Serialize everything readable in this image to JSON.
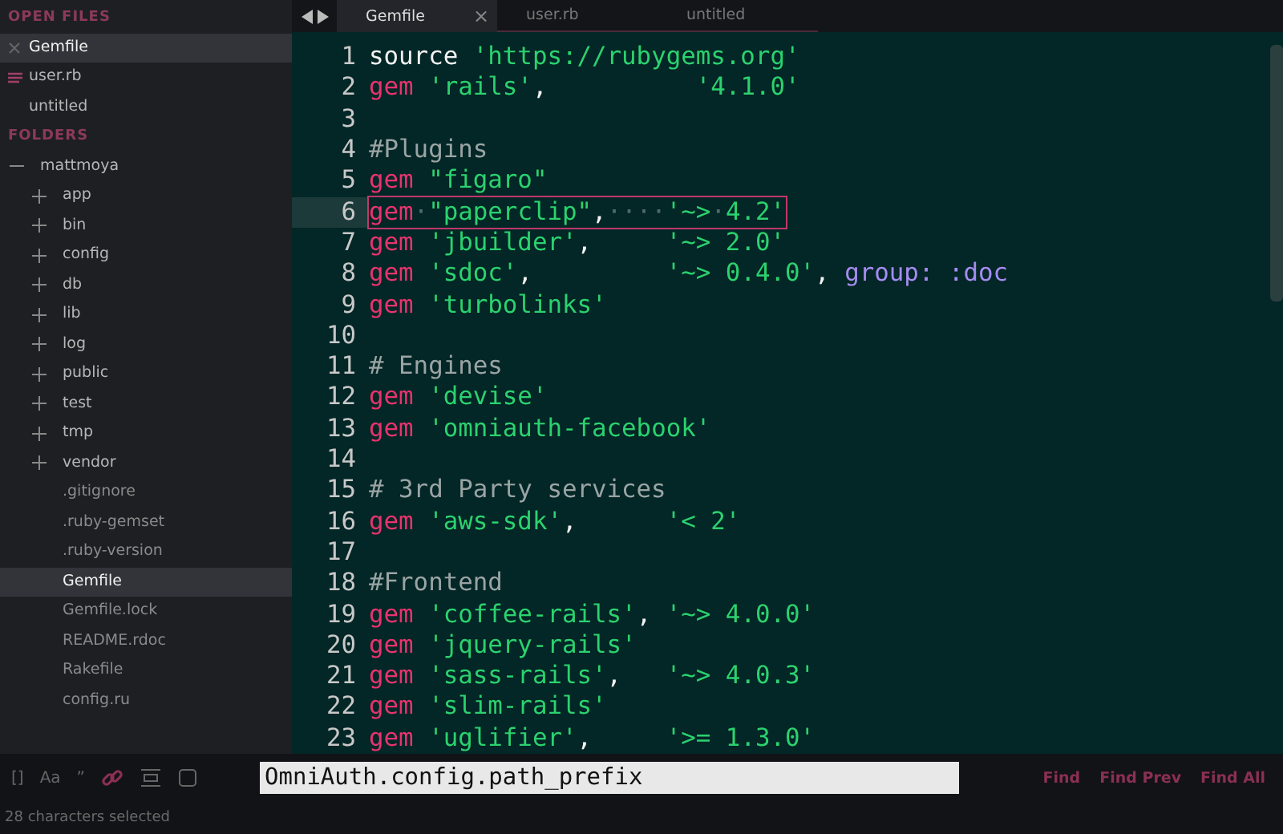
{
  "sidebar": {
    "open_files_header": "OPEN FILES",
    "open_files": [
      {
        "label": "Gemfile",
        "selected": true,
        "modified": false
      },
      {
        "label": "user.rb",
        "selected": false,
        "modified": true
      },
      {
        "label": "untitled",
        "selected": false,
        "modified": false
      }
    ],
    "folders_header": "FOLDERS",
    "tree": [
      {
        "label": "mattmoya",
        "kind": "folder",
        "expanded": true,
        "selected": false,
        "children": [
          {
            "label": "app",
            "kind": "folder",
            "expanded": false,
            "selected": false
          },
          {
            "label": "bin",
            "kind": "folder",
            "expanded": false,
            "selected": false
          },
          {
            "label": "config",
            "kind": "folder",
            "expanded": false,
            "selected": false
          },
          {
            "label": "db",
            "kind": "folder",
            "expanded": false,
            "selected": false
          },
          {
            "label": "lib",
            "kind": "folder",
            "expanded": false,
            "selected": false
          },
          {
            "label": "log",
            "kind": "folder",
            "expanded": false,
            "selected": false
          },
          {
            "label": "public",
            "kind": "folder",
            "expanded": false,
            "selected": false
          },
          {
            "label": "test",
            "kind": "folder",
            "expanded": false,
            "selected": false
          },
          {
            "label": "tmp",
            "kind": "folder",
            "expanded": false,
            "selected": false
          },
          {
            "label": "vendor",
            "kind": "folder",
            "expanded": false,
            "selected": false
          },
          {
            "label": ".gitignore",
            "kind": "file",
            "selected": false
          },
          {
            "label": ".ruby-gemset",
            "kind": "file",
            "selected": false
          },
          {
            "label": ".ruby-version",
            "kind": "file",
            "selected": false
          },
          {
            "label": "Gemfile",
            "kind": "file",
            "selected": true
          },
          {
            "label": "Gemfile.lock",
            "kind": "file",
            "selected": false
          },
          {
            "label": "README.rdoc",
            "kind": "file",
            "selected": false
          },
          {
            "label": "Rakefile",
            "kind": "file",
            "selected": false
          },
          {
            "label": "config.ru",
            "kind": "file",
            "selected": false
          }
        ]
      }
    ]
  },
  "tabs": [
    {
      "label": "Gemfile",
      "selected": true,
      "close": "×"
    },
    {
      "label": "user.rb",
      "selected": false
    },
    {
      "label": "untitled",
      "selected": false
    }
  ],
  "editor": {
    "lines": [
      {
        "number": "1",
        "tokens": [
          {
            "kind": "plain",
            "text": "source"
          },
          {
            "kind": "string",
            "text": " 'https://rubygems.org'"
          }
        ]
      },
      {
        "number": "2",
        "tokens": [
          {
            "kind": "keyword",
            "text": "gem"
          },
          {
            "kind": "string",
            "text": " 'rails'"
          },
          {
            "kind": "plain",
            "text": ",          "
          },
          {
            "kind": "string",
            "text": "'4.1.0'"
          }
        ]
      },
      {
        "number": "3"
      },
      {
        "number": "4",
        "tokens": [
          {
            "kind": "comment",
            "text": "#Plugins"
          }
        ]
      },
      {
        "number": "5",
        "tokens": [
          {
            "kind": "keyword",
            "text": "gem"
          },
          {
            "kind": "string",
            "text": " \"figaro\""
          }
        ]
      },
      {
        "number": "6",
        "current": true,
        "match": true,
        "tokens": [
          {
            "kind": "keyword",
            "text": "gem"
          },
          {
            "kind": "space",
            "text": "·"
          },
          {
            "kind": "string",
            "text": "\"paperclip\""
          },
          {
            "kind": "plain",
            "text": ","
          },
          {
            "kind": "space",
            "text": "····"
          },
          {
            "kind": "string",
            "text": "'~>"
          },
          {
            "kind": "space",
            "text": "·"
          },
          {
            "kind": "string",
            "text": "4.2'"
          }
        ]
      },
      {
        "number": "7",
        "tokens": [
          {
            "kind": "keyword",
            "text": "gem"
          },
          {
            "kind": "string",
            "text": " 'jbuilder'"
          },
          {
            "kind": "plain",
            "text": ",     "
          },
          {
            "kind": "string",
            "text": "'~> 2.0'"
          }
        ]
      },
      {
        "number": "8",
        "tokens": [
          {
            "kind": "keyword",
            "text": "gem"
          },
          {
            "kind": "string",
            "text": " 'sdoc'"
          },
          {
            "kind": "plain",
            "text": ",         "
          },
          {
            "kind": "string",
            "text": "'~> 0.4.0'"
          },
          {
            "kind": "plain",
            "text": ", "
          },
          {
            "kind": "symbol",
            "text": "group: :doc"
          }
        ]
      },
      {
        "number": "9",
        "tokens": [
          {
            "kind": "keyword",
            "text": "gem"
          },
          {
            "kind": "string",
            "text": " 'turbolinks'"
          }
        ]
      },
      {
        "number": "10"
      },
      {
        "number": "11",
        "tokens": [
          {
            "kind": "comment",
            "text": "# Engines"
          }
        ]
      },
      {
        "number": "12",
        "tokens": [
          {
            "kind": "keyword",
            "text": "gem"
          },
          {
            "kind": "string",
            "text": " 'devise'"
          }
        ]
      },
      {
        "number": "13",
        "tokens": [
          {
            "kind": "keyword",
            "text": "gem"
          },
          {
            "kind": "string",
            "text": " 'omniauth-facebook'"
          }
        ]
      },
      {
        "number": "14"
      },
      {
        "number": "15",
        "tokens": [
          {
            "kind": "comment",
            "text": "# 3rd Party services"
          }
        ]
      },
      {
        "number": "16",
        "tokens": [
          {
            "kind": "keyword",
            "text": "gem"
          },
          {
            "kind": "string",
            "text": " 'aws-sdk'"
          },
          {
            "kind": "plain",
            "text": ",      "
          },
          {
            "kind": "string",
            "text": "'< 2'"
          }
        ]
      },
      {
        "number": "17"
      },
      {
        "number": "18",
        "tokens": [
          {
            "kind": "comment",
            "text": "#Frontend"
          }
        ]
      },
      {
        "number": "19",
        "tokens": [
          {
            "kind": "keyword",
            "text": "gem"
          },
          {
            "kind": "string",
            "text": " 'coffee-rails'"
          },
          {
            "kind": "plain",
            "text": ", "
          },
          {
            "kind": "string",
            "text": "'~> 4.0.0'"
          }
        ]
      },
      {
        "number": "20",
        "tokens": [
          {
            "kind": "keyword",
            "text": "gem"
          },
          {
            "kind": "string",
            "text": " 'jquery-rails'"
          }
        ]
      },
      {
        "number": "21",
        "tokens": [
          {
            "kind": "keyword",
            "text": "gem"
          },
          {
            "kind": "string",
            "text": " 'sass-rails'"
          },
          {
            "kind": "plain",
            "text": ",   "
          },
          {
            "kind": "string",
            "text": "'~> 4.0.3'"
          }
        ]
      },
      {
        "number": "22",
        "tokens": [
          {
            "kind": "keyword",
            "text": "gem"
          },
          {
            "kind": "string",
            "text": " 'slim-rails'"
          }
        ]
      },
      {
        "number": "23",
        "tokens": [
          {
            "kind": "keyword",
            "text": "gem"
          },
          {
            "kind": "string",
            "text": " 'uglifier'"
          },
          {
            "kind": "plain",
            "text": ",     "
          },
          {
            "kind": "string",
            "text": "'>= 1.3.0'"
          }
        ]
      }
    ]
  },
  "find_panel": {
    "options": [
      {
        "kind": "regex",
        "label": "[]",
        "on": false
      },
      {
        "kind": "case",
        "label": "Aa",
        "on": false
      },
      {
        "kind": "word",
        "label": "”",
        "on": false
      },
      {
        "kind": "wrap",
        "on": true
      },
      {
        "kind": "selection",
        "on": false
      },
      {
        "kind": "highlight",
        "on": false
      }
    ],
    "value": "OmniAuth.config.path_prefix",
    "buttons": [
      "Find",
      "Find Prev",
      "Find All"
    ]
  },
  "status_bar": {
    "text": "28 characters selected"
  }
}
